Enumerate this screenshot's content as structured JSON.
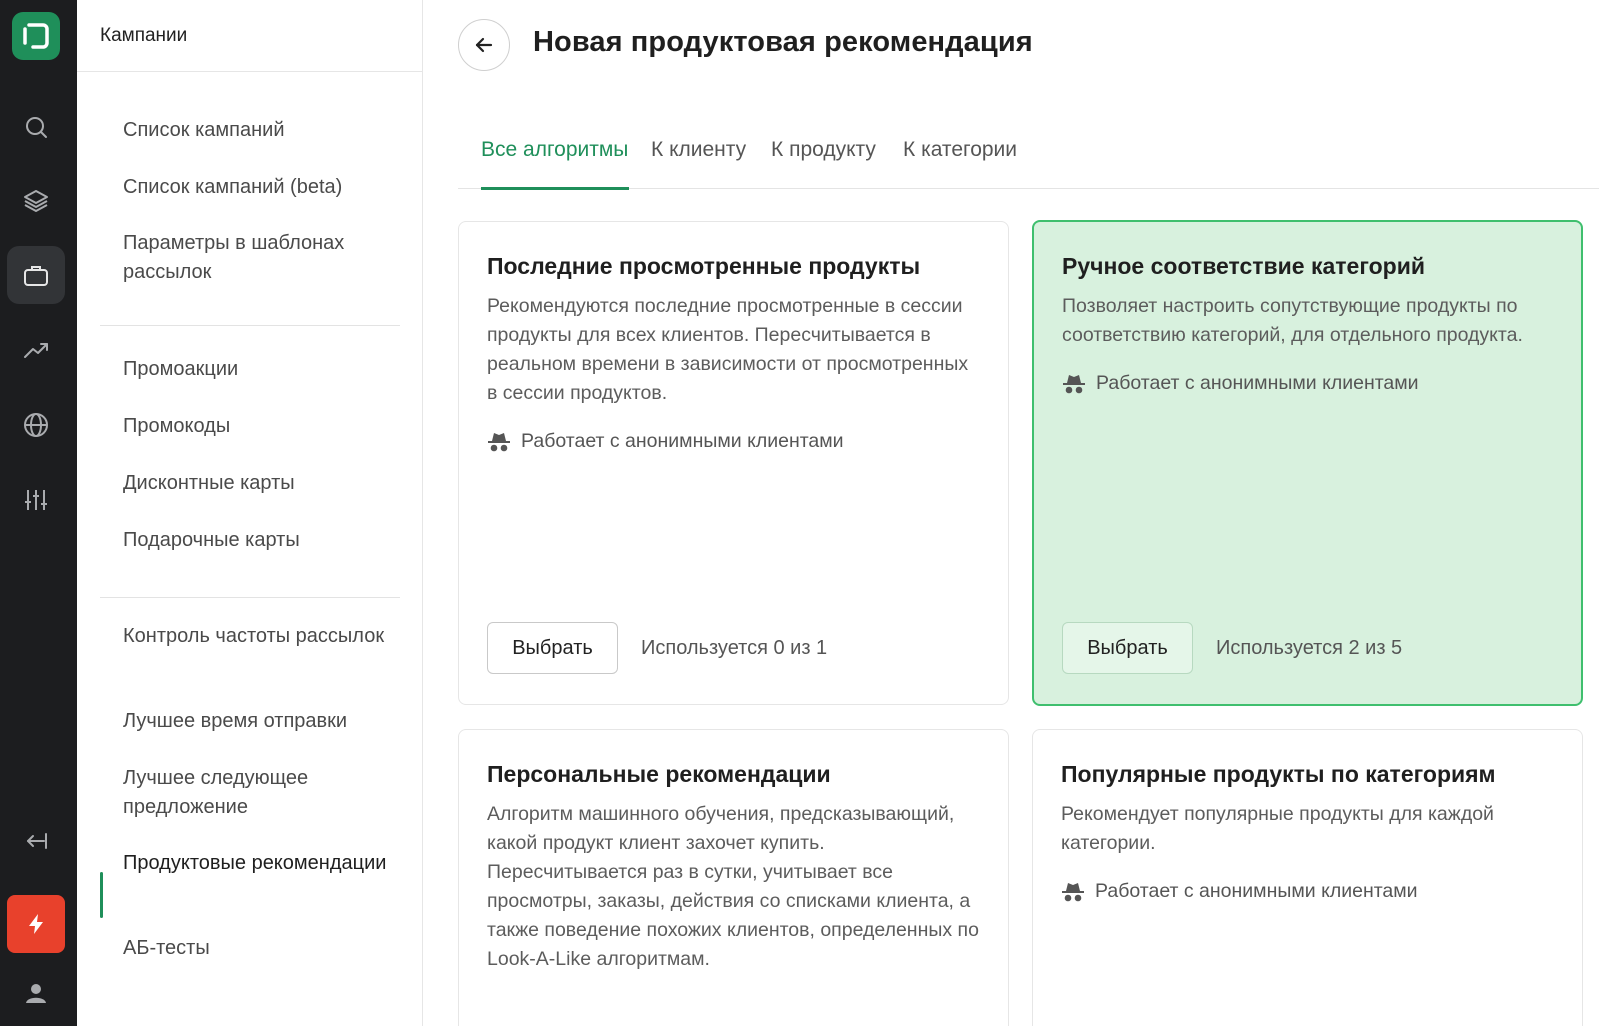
{
  "sidebar": {
    "title": "Кампании",
    "items": [
      {
        "label": "Список кампаний"
      },
      {
        "label": "Список кампаний (beta)"
      },
      {
        "label": "Параметры в шаблонах рассылок"
      },
      {
        "label": "Промоакции"
      },
      {
        "label": "Промокоды"
      },
      {
        "label": "Дисконтные карты"
      },
      {
        "label": "Подарочные карты"
      },
      {
        "label": "Контроль частоты рассылок"
      },
      {
        "label": "Лучшее время отправки"
      },
      {
        "label": "Лучшее следующее предложение"
      },
      {
        "label": "Продуктовые рекомендации"
      },
      {
        "label": "АБ-тесты"
      }
    ]
  },
  "rail": {
    "icons": [
      "logo-icon",
      "search-icon",
      "layers-icon",
      "briefcase-icon",
      "trending-up-icon",
      "globe-icon",
      "sliders-icon",
      "collapse-icon",
      "bolt-icon",
      "user-icon"
    ],
    "accent": "#1f8f5a",
    "bolt_color": "#e8412c"
  },
  "header": {
    "title": "Новая продуктовая рекомендация"
  },
  "tabs": [
    {
      "label": "Все алгоритмы"
    },
    {
      "label": "К клиенту"
    },
    {
      "label": "К продукту"
    },
    {
      "label": "К категории"
    }
  ],
  "cards": [
    {
      "title": "Последние просмотренные продукты",
      "description": "Рекомендуются последние просмотренные в сессии продукты для всех клиентов. Пересчитывается в реальном времени в зависимости от просмотренных в сессии продуктов.",
      "anon": "Работает с анонимными клиентами",
      "button": "Выбрать",
      "usage": "Используется 0 из 1"
    },
    {
      "title": "Ручное соответствие категорий",
      "description": "Позволяет настроить сопутствующие продукты по соответствию категорий, для отдельного продукта.",
      "anon": "Работает с анонимными клиентами",
      "button": "Выбрать",
      "usage": "Используется 2 из 5"
    },
    {
      "title": "Персональные рекомендации",
      "description": "Алгоритм машинного обучения, предсказывающий, какой продукт клиент захочет купить. Пересчитывается раз в сутки, учитывает все просмотры, заказы, действия со списками клиента, а также поведение похожих клиентов, определенных по Look-A-Like алгоритмам."
    },
    {
      "title": "Популярные продукты по категориям",
      "description": "Рекомендует популярные продукты для каждой категории.",
      "anon": "Работает с анонимными клиентами"
    }
  ]
}
